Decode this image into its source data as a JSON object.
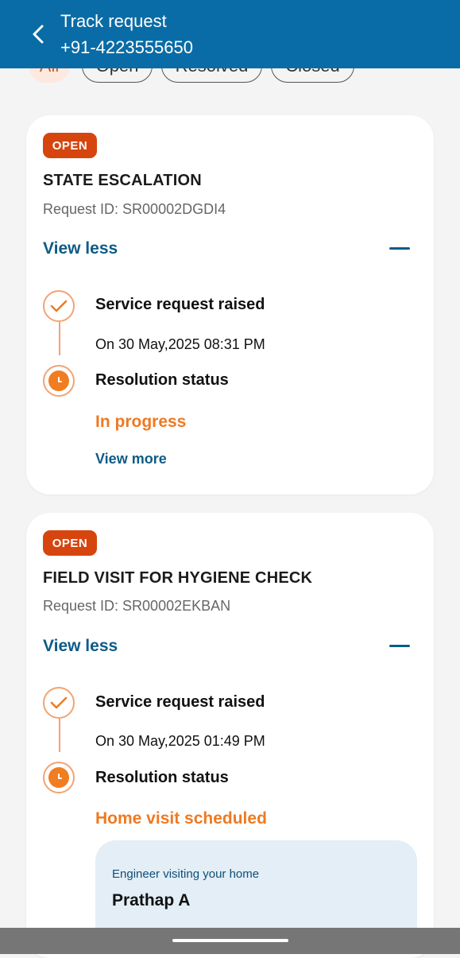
{
  "header": {
    "title": "Track request",
    "subtitle": "+91-4223555650"
  },
  "filters": [
    {
      "label": "All",
      "active": true
    },
    {
      "label": "Open",
      "active": false
    },
    {
      "label": "Resolved",
      "active": false
    },
    {
      "label": "Closed",
      "active": false
    }
  ],
  "cards": [
    {
      "badge": "OPEN",
      "title": "STATE ESCALATION",
      "request_id": "Request ID: SR00002DGDI4",
      "toggle_label": "View less",
      "steps": [
        {
          "label": "Service request raised",
          "detail": "On 30 May,2025 08:31 PM"
        },
        {
          "label": "Resolution status",
          "detail": "In progress"
        }
      ],
      "view_more": "View more"
    },
    {
      "badge": "OPEN",
      "title": "FIELD VISIT FOR HYGIENE CHECK",
      "request_id": "Request ID: SR00002EKBAN",
      "toggle_label": "View less",
      "steps": [
        {
          "label": "Service request raised",
          "detail": "On 30 May,2025 01:49 PM"
        },
        {
          "label": "Resolution status",
          "detail": "Home visit scheduled"
        }
      ],
      "engineer": {
        "label": "Engineer visiting your home",
        "name": "Prathap A"
      }
    }
  ],
  "colors": {
    "header": "#0a6ca6",
    "badge": "#d6450e",
    "accent_orange": "#ee7a22",
    "link_blue": "#0e5b86"
  }
}
